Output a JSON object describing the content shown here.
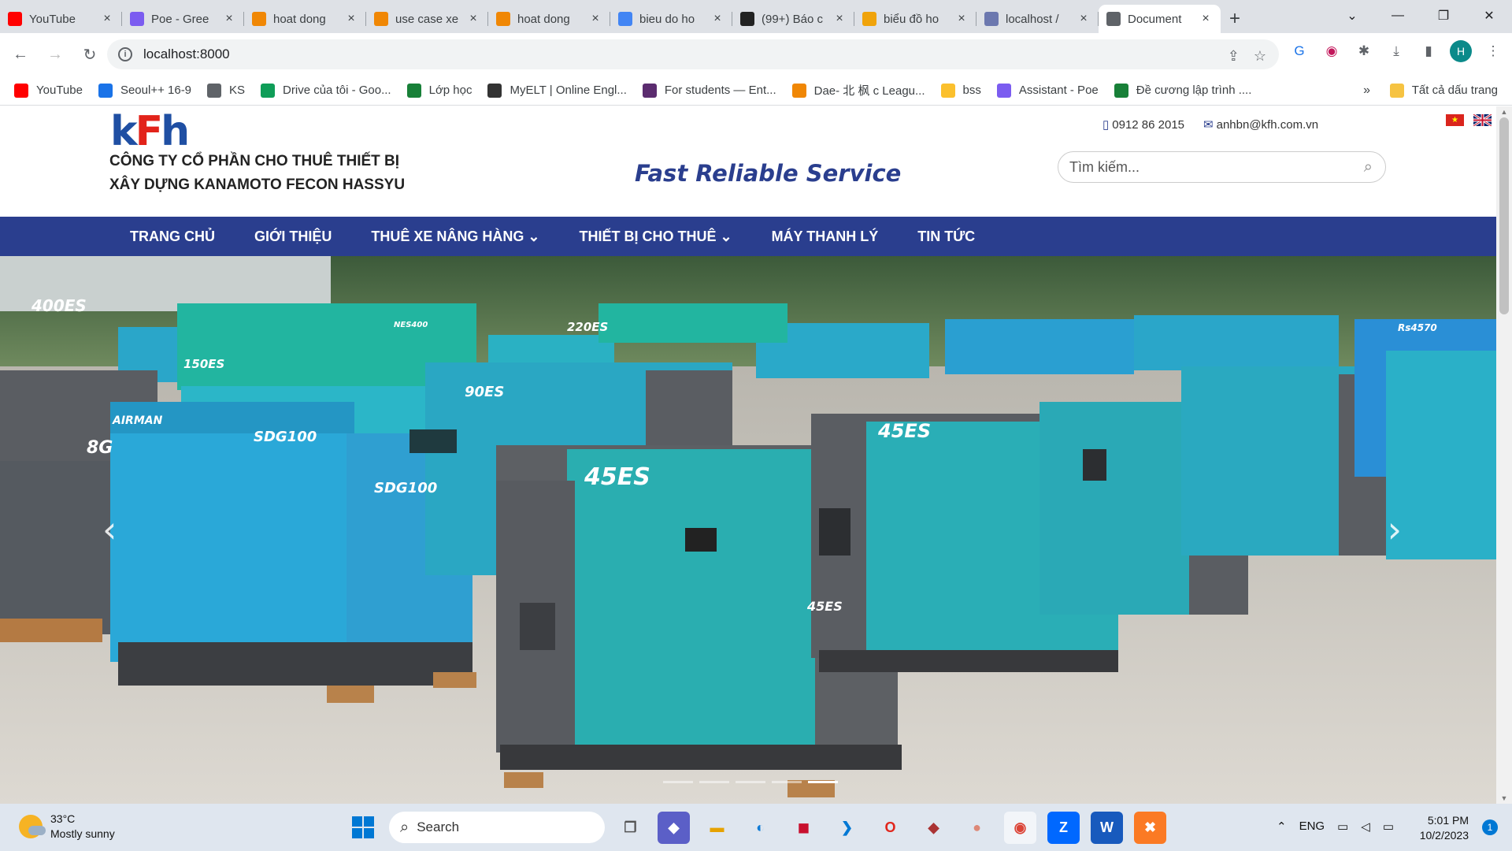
{
  "browser": {
    "tabs": [
      {
        "label": "YouTube",
        "icon": "youtube-icon",
        "color": "#ff0000"
      },
      {
        "label": "Poe - Gree",
        "icon": "poe-icon",
        "color": "#7b5cf0"
      },
      {
        "label": "hoat dong",
        "icon": "drawio-icon",
        "color": "#f08705"
      },
      {
        "label": "use case xe",
        "icon": "drawio-icon",
        "color": "#f08705"
      },
      {
        "label": "hoat dong",
        "icon": "drawio-icon",
        "color": "#f08705"
      },
      {
        "label": "bieu do ho",
        "icon": "google-icon",
        "color": "#4285f4"
      },
      {
        "label": "(99+) Báo c",
        "icon": "a-icon",
        "color": "#222222"
      },
      {
        "label": "biểu đồ ho",
        "icon": "123-icon",
        "color": "#f0a30a"
      },
      {
        "label": "localhost /",
        "icon": "phpmyadmin-icon",
        "color": "#6c78af"
      },
      {
        "label": "Document",
        "icon": "globe-icon",
        "color": "#5f6368",
        "active": true
      }
    ],
    "new_tab": "+",
    "url": "localhost:8000",
    "profile_initial": "H",
    "bookmarks": [
      {
        "label": "YouTube",
        "color": "#ff0000"
      },
      {
        "label": "Seoul++ 16-9",
        "color": "#1a73e8"
      },
      {
        "label": "KS",
        "color": "#5f6368"
      },
      {
        "label": "Drive của tôi - Goo...",
        "color": "#0f9d58"
      },
      {
        "label": "Lớp học",
        "color": "#188038"
      },
      {
        "label": "MyELT | Online Engl...",
        "color": "#333333"
      },
      {
        "label": "For students — Ent...",
        "color": "#5b2c6f"
      },
      {
        "label": "Dae- 北 枫 c Leagu...",
        "color": "#f08705"
      },
      {
        "label": "bss",
        "color": "#fbc02d"
      },
      {
        "label": "Assistant - Poe",
        "color": "#7b5cf0"
      },
      {
        "label": "Đề cương lập trình ....",
        "color": "#188038"
      }
    ],
    "bookmarks_more": "»",
    "all_bookmarks": "Tất cả dấu trang"
  },
  "site": {
    "logo_k": "k",
    "logo_f": "F",
    "logo_h": "h",
    "company_line1": "CÔNG TY CỔ PHẦN CHO THUÊ THIẾT BỊ",
    "company_line2": "XÂY DỰNG KANAMOTO FECON HASSYU",
    "slogan": "Fast Reliable Service",
    "phone": "0912 86 2015",
    "email": "anhbn@kfh.com.vn",
    "search_placeholder": "Tìm kiếm...",
    "nav": [
      {
        "label": "TRANG CHỦ",
        "dropdown": false
      },
      {
        "label": "GIỚI THIỆU",
        "dropdown": false
      },
      {
        "label": "THUÊ XE NÂNG HÀNG",
        "dropdown": true
      },
      {
        "label": "THIẾT BỊ CHO THUÊ",
        "dropdown": true
      },
      {
        "label": "MÁY THANH LÝ",
        "dropdown": false
      },
      {
        "label": "TIN TỨC",
        "dropdown": false
      }
    ],
    "colors": {
      "brand_blue": "#2a3e8e",
      "logo_red": "#e2231a"
    },
    "hero": {
      "labels": [
        "400ES",
        "NES400",
        "220ES",
        "150ES",
        "AIRMAN",
        "SDG100",
        "SDG100",
        "90ES",
        "45ES",
        "45ES",
        "45ES",
        "8G",
        "Rs4570"
      ],
      "slides": 5,
      "active_slide": 4
    }
  },
  "taskbar": {
    "temp": "33°C",
    "weather": "Mostly sunny",
    "search": "Search",
    "lang": "ENG",
    "time": "5:01 PM",
    "date": "10/2/2023",
    "notifications": "1"
  }
}
